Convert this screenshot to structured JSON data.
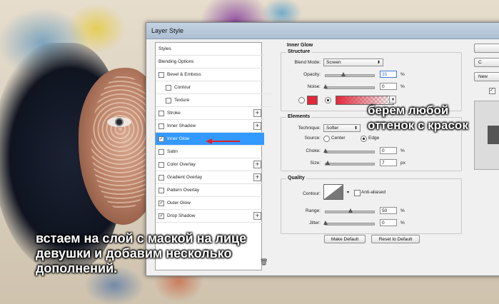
{
  "dialog": {
    "title": "Layer Style"
  },
  "styles_list": {
    "items": [
      {
        "label": "Styles",
        "checkbox": false,
        "checked": false,
        "plus": false,
        "selected": false,
        "indent": 0
      },
      {
        "label": "Blending Options",
        "checkbox": false,
        "checked": false,
        "plus": false,
        "selected": false,
        "indent": 0
      },
      {
        "label": "Bevel & Emboss",
        "checkbox": true,
        "checked": false,
        "plus": false,
        "selected": false,
        "indent": 0
      },
      {
        "label": "Contour",
        "checkbox": true,
        "checked": false,
        "plus": false,
        "selected": false,
        "indent": 1
      },
      {
        "label": "Texture",
        "checkbox": true,
        "checked": false,
        "plus": false,
        "selected": false,
        "indent": 1
      },
      {
        "label": "Stroke",
        "checkbox": true,
        "checked": false,
        "plus": true,
        "selected": false,
        "indent": 0
      },
      {
        "label": "Inner Shadow",
        "checkbox": true,
        "checked": false,
        "plus": true,
        "selected": false,
        "indent": 0
      },
      {
        "label": "Inner Glow",
        "checkbox": true,
        "checked": true,
        "plus": false,
        "selected": true,
        "indent": 0
      },
      {
        "label": "Satin",
        "checkbox": true,
        "checked": false,
        "plus": false,
        "selected": false,
        "indent": 0
      },
      {
        "label": "Color Overlay",
        "checkbox": true,
        "checked": false,
        "plus": true,
        "selected": false,
        "indent": 0
      },
      {
        "label": "Gradient Overlay",
        "checkbox": true,
        "checked": false,
        "plus": true,
        "selected": false,
        "indent": 0
      },
      {
        "label": "Pattern Overlay",
        "checkbox": true,
        "checked": false,
        "plus": false,
        "selected": false,
        "indent": 0
      },
      {
        "label": "Outer Glow",
        "checkbox": true,
        "checked": true,
        "plus": false,
        "selected": false,
        "indent": 0
      },
      {
        "label": "Drop Shadow",
        "checkbox": true,
        "checked": true,
        "plus": true,
        "selected": false,
        "indent": 0
      }
    ]
  },
  "inner_glow": {
    "title": "Inner Glow",
    "structure": {
      "title": "Structure",
      "blend_mode_label": "Blend Mode:",
      "blend_mode_value": "Screen",
      "opacity_label": "Opacity:",
      "opacity_value": "35",
      "opacity_unit": "%",
      "opacity_level": 0.35,
      "noise_label": "Noise:",
      "noise_value": "0",
      "noise_unit": "%",
      "noise_level": 0,
      "glow_color": "#e0283a"
    },
    "elements": {
      "title": "Elements",
      "technique_label": "Technique:",
      "technique_value": "Softer",
      "source_label": "Source:",
      "source_center": "Center",
      "source_edge": "Edge",
      "choke_label": "Choke:",
      "choke_value": "0",
      "choke_unit": "%",
      "choke_level": 0,
      "size_label": "Size:",
      "size_value": "7",
      "size_unit": "px",
      "size_level": 0.04
    },
    "quality": {
      "title": "Quality",
      "contour_label": "Contour:",
      "anti_aliased_label": "Anti-aliased",
      "range_label": "Range:",
      "range_value": "50",
      "range_unit": "%",
      "range_level": 0.5,
      "jitter_label": "Jitter:",
      "jitter_value": "0",
      "jitter_unit": "%",
      "jitter_level": 0
    },
    "make_default": "Make Default",
    "reset_default": "Reset to Default"
  },
  "right_buttons": {
    "cancel_partial": "C",
    "new_partial": "New"
  },
  "captions": {
    "left": "встаем на слой с маской на лице\nдевушки и добавим несколько\nдополнений.",
    "right": "берем любой\nоттенок с красок"
  },
  "colors": {
    "accent": "#3399ff",
    "arrow": "#e0202a"
  }
}
